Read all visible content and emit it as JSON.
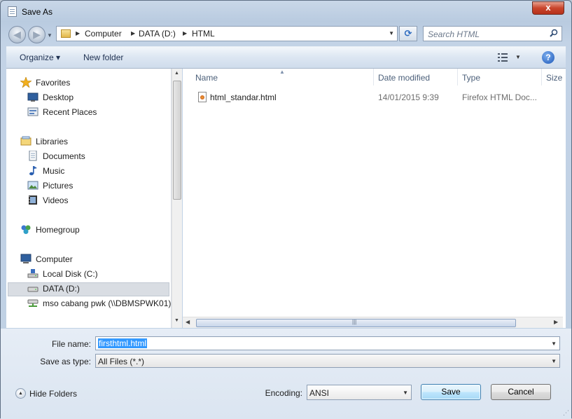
{
  "window": {
    "title": "Save As",
    "close_glyph": "x"
  },
  "nav": {
    "back_glyph": "◀",
    "forward_glyph": "▶",
    "breadcrumbs": [
      "Computer",
      "DATA (D:)",
      "HTML"
    ],
    "search_placeholder": "Search HTML",
    "refresh_glyph": "⟳"
  },
  "toolbar": {
    "organize_label": "Organize ▾",
    "new_folder_label": "New folder",
    "help_glyph": "?"
  },
  "sidebar": {
    "favorites_header": "Favorites",
    "favorites": [
      "Desktop",
      "Recent Places"
    ],
    "libraries_header": "Libraries",
    "libraries": [
      "Documents",
      "Music",
      "Pictures",
      "Videos"
    ],
    "homegroup": "Homegroup",
    "computer_header": "Computer",
    "drives": [
      "Local Disk (C:)",
      "DATA (D:)",
      "mso cabang pwk (\\\\DBMSPWK01)"
    ],
    "selected": "DATA (D:)"
  },
  "files": {
    "columns": [
      "Name",
      "Date modified",
      "Type",
      "Size"
    ],
    "rows": [
      {
        "name": "html_standar.html",
        "date": "14/01/2015 9:39",
        "type": "Firefox HTML Doc..."
      }
    ]
  },
  "form": {
    "filename_label": "File name:",
    "filename_value": "firsthtml.html",
    "savetype_label": "Save as type:",
    "savetype_value": "All Files  (*.*)",
    "encoding_label": "Encoding:",
    "encoding_value": "ANSI",
    "save_label": "Save",
    "cancel_label": "Cancel",
    "hide_folders_label": "Hide Folders"
  },
  "colors": {
    "accent": "#3399ff",
    "close": "#c9452c",
    "selected_row": "#d9dde3"
  },
  "icons": [
    "star-icon",
    "desktop-icon",
    "recent-places-icon",
    "libraries-icon",
    "documents-icon",
    "music-icon",
    "pictures-icon",
    "videos-icon",
    "homegroup-icon",
    "computer-icon",
    "local-disk-icon",
    "drive-icon",
    "network-drive-icon",
    "html-file-icon",
    "search-icon",
    "help-icon",
    "view-options-icon"
  ]
}
